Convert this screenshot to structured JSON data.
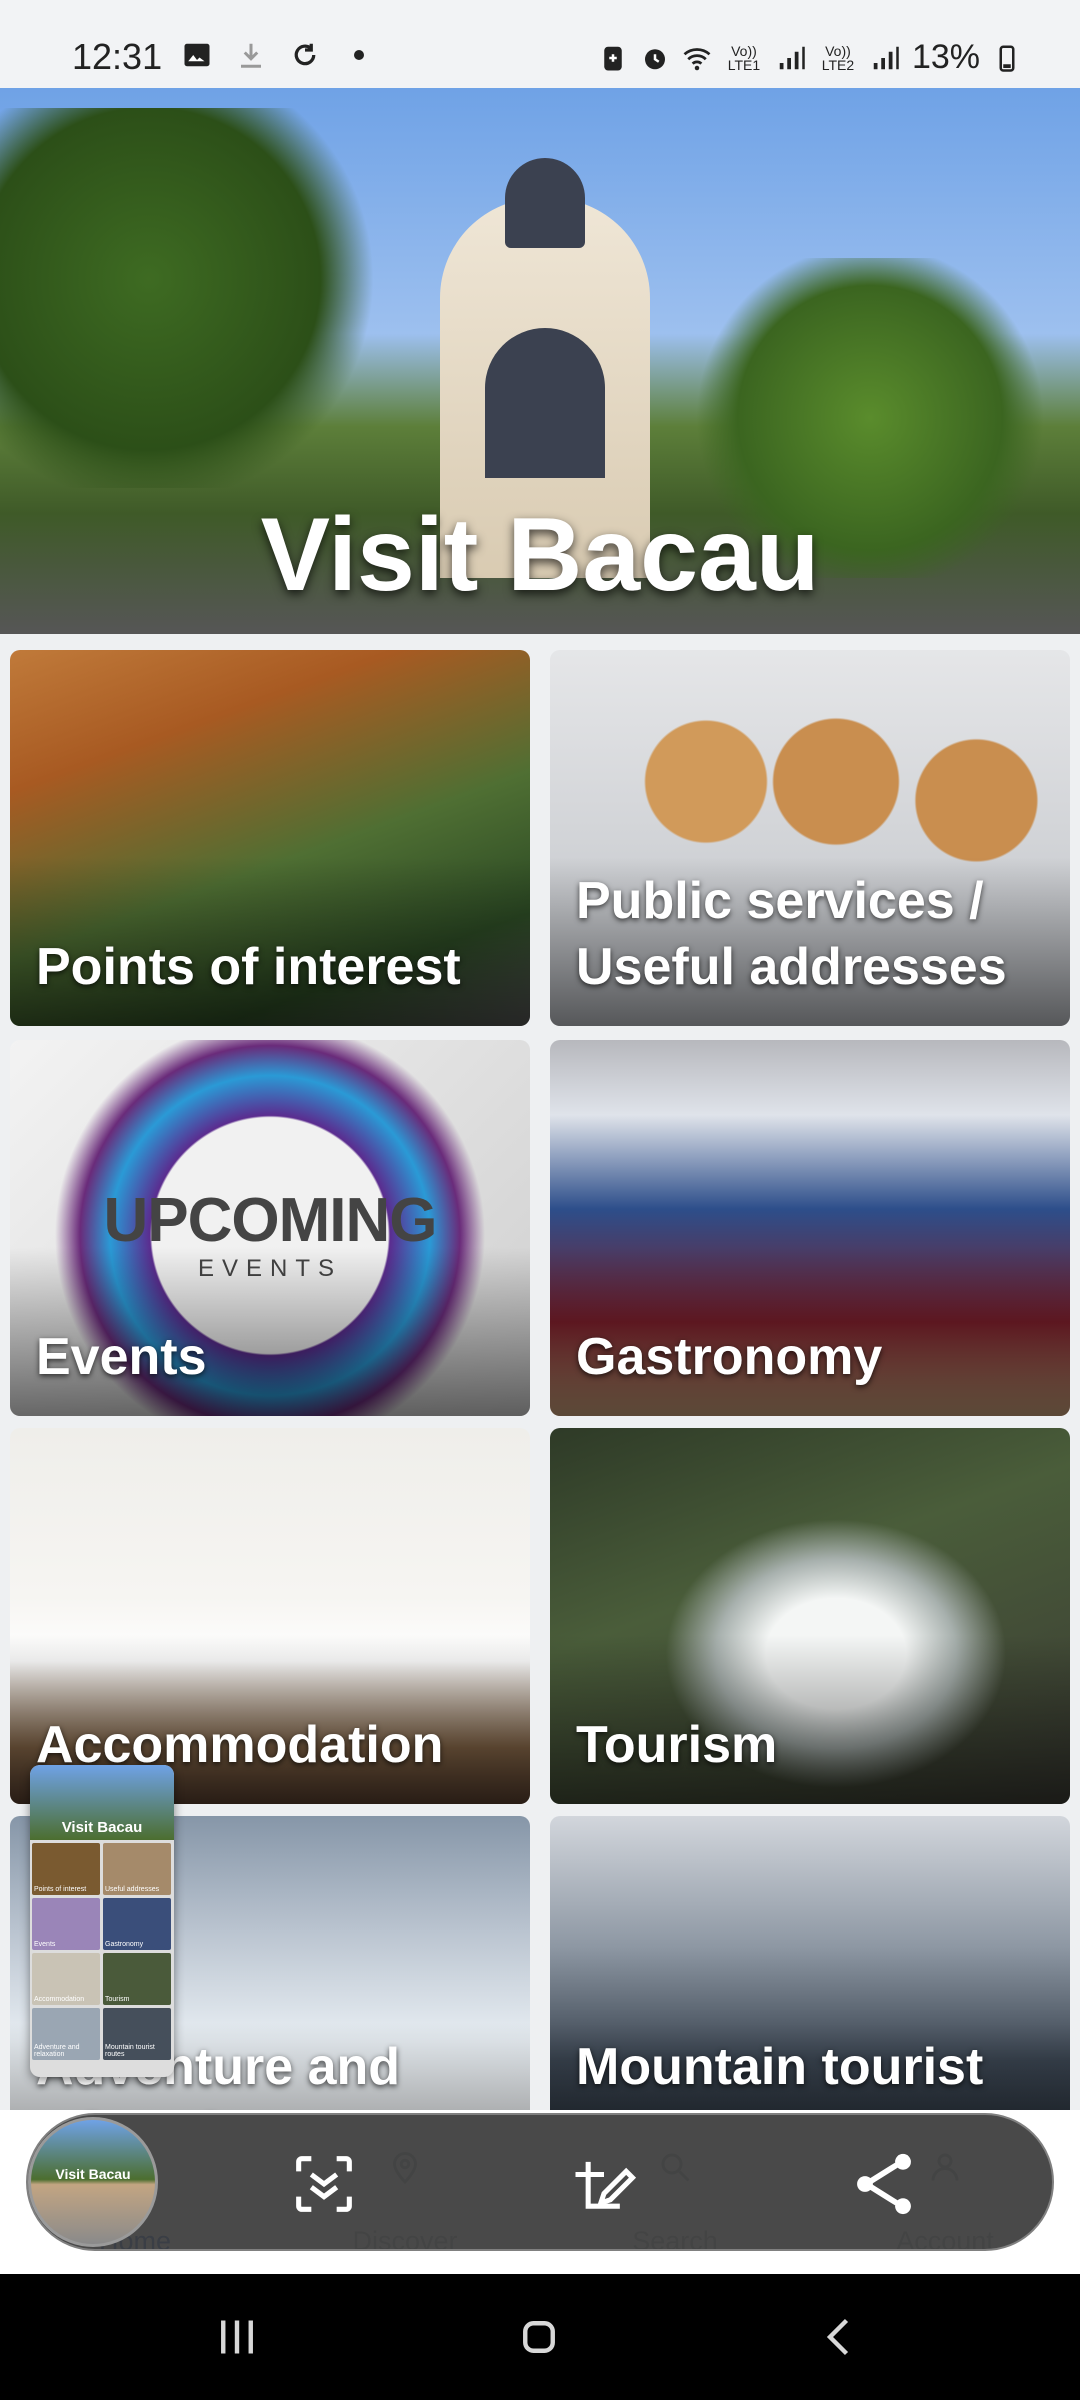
{
  "status_bar": {
    "time": "12:31",
    "battery": "13%",
    "sim1": "Vo)) LTE1",
    "sim2": "Vo)) LTE2",
    "icons": [
      "image-icon",
      "download-icon",
      "sync-icon",
      "dot-icon",
      "battery-saver-icon",
      "alarm-icon",
      "wifi-icon",
      "signal-icon",
      "signal-icon",
      "battery-icon"
    ]
  },
  "hero": {
    "title": "Visit Bacau"
  },
  "tiles": [
    {
      "label": "Points of interest"
    },
    {
      "label": "Public services / Useful addresses"
    },
    {
      "label": "Events",
      "poster_title": "UPCOMING",
      "poster_subtitle": "EVENTS"
    },
    {
      "label": "Gastronomy"
    },
    {
      "label": "Accommodation"
    },
    {
      "label": "Tourism"
    },
    {
      "label": "Adventure and relaxation"
    },
    {
      "label": "Mountain tourist routes"
    }
  ],
  "thumbnail": {
    "title": "Visit Bacau",
    "cells": [
      "Points of interest",
      "Useful addresses",
      "Events",
      "Gastronomy",
      "Accommodation",
      "Tourism",
      "Adventure and relaxation",
      "Mountain tourist routes"
    ]
  },
  "bottom_nav": [
    {
      "label": "Home",
      "icon": "home-icon",
      "active": true
    },
    {
      "label": "Discover",
      "icon": "location-pin-icon",
      "active": false
    },
    {
      "label": "Search",
      "icon": "search-icon",
      "active": false
    },
    {
      "label": "Account",
      "icon": "person-icon",
      "active": false
    }
  ],
  "screenshot_toolbar": {
    "preview_title": "Visit Bacau",
    "buttons": [
      "scroll-capture-icon",
      "edit-icon",
      "share-icon"
    ]
  },
  "system_nav": [
    "recents-icon",
    "home-button-icon",
    "back-icon"
  ],
  "colors": {
    "accent": "#3f71c9",
    "toolbar": "#3a3a3a",
    "background": "#eef0f2"
  }
}
